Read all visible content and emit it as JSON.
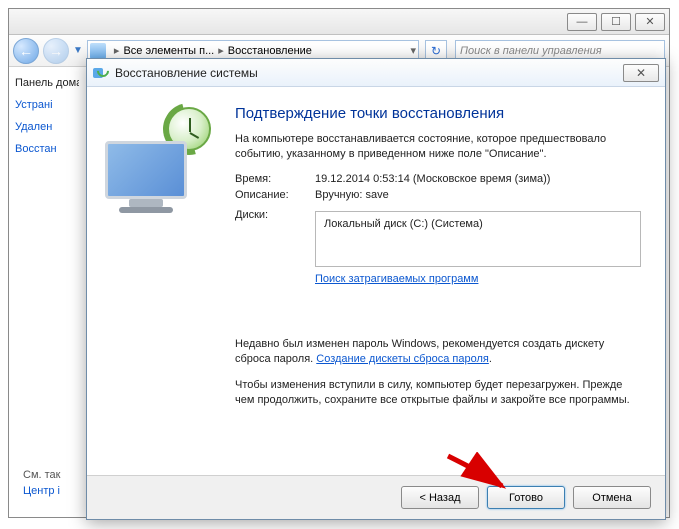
{
  "parent": {
    "breadcrumb": {
      "item1": "Все элементы п...",
      "item2": "Восстановление"
    },
    "search_placeholder": "Поиск в панели управления",
    "sidebar": {
      "items": [
        "Панель домашн",
        "Устрані",
        "Удален",
        "Восстан"
      ],
      "footer_see": "См. так",
      "footer_center": "Центр і"
    }
  },
  "dialog": {
    "title": "Восстановление системы",
    "heading": "Подтверждение точки восстановления",
    "description": "На компьютере восстанавливается состояние, которое предшествовало событию, указанному в приведенном ниже поле \"Описание\".",
    "rows": {
      "time_label": "Время:",
      "time_value": "19.12.2014 0:53:14 (Московское время (зима))",
      "desc_label": "Описание:",
      "desc_value": "Вручную: save",
      "disks_label": "Диски:",
      "disks_value": "Локальный диск (C:) (Система)"
    },
    "scan_link": "Поиск затрагиваемых программ",
    "pw_text_pre": "Недавно был изменен пароль Windows, рекомендуется создать дискету сброса пароля. ",
    "pw_link": "Создание дискеты сброса пароля",
    "reboot_text": "Чтобы изменения вступили в силу, компьютер будет перезагружен. Прежде чем продолжить, сохраните все открытые файлы и закройте все программы.",
    "buttons": {
      "back": "< Назад",
      "finish": "Готово",
      "cancel": "Отмена"
    }
  }
}
